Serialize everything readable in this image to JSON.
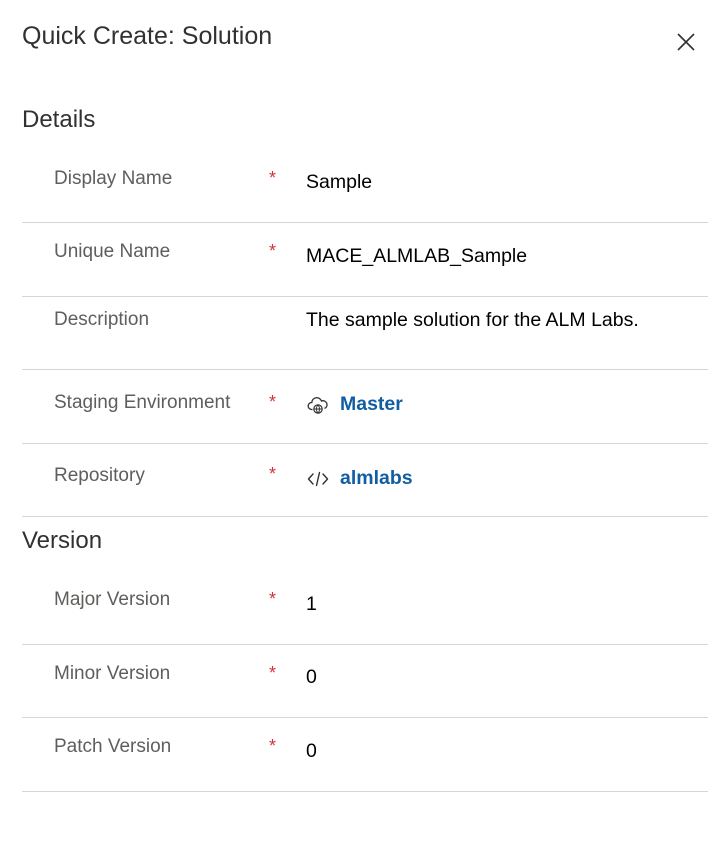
{
  "panel": {
    "title": "Quick Create: Solution",
    "close_label": "Close"
  },
  "sections": {
    "details": {
      "heading": "Details",
      "fields": {
        "display_name": {
          "label": "Display Name",
          "required": "*",
          "value": "Sample"
        },
        "unique_name": {
          "label": "Unique Name",
          "required": "*",
          "value": "MACE_ALMLAB_Sample"
        },
        "description": {
          "label": "Description",
          "value": "The sample solution for the ALM Labs."
        },
        "staging_environment": {
          "label": "Staging Environment",
          "required": "*",
          "value": "Master",
          "icon": "cloud-globe-icon"
        },
        "repository": {
          "label": "Repository",
          "required": "*",
          "value": "almlabs",
          "icon": "code-icon"
        }
      }
    },
    "version": {
      "heading": "Version",
      "fields": {
        "major_version": {
          "label": "Major Version",
          "required": "*",
          "value": "1"
        },
        "minor_version": {
          "label": "Minor Version",
          "required": "*",
          "value": "0"
        },
        "patch_version": {
          "label": "Patch Version",
          "required": "*",
          "value": "0"
        }
      }
    }
  },
  "colors": {
    "required": "#d13438",
    "link": "#115ea3",
    "divider": "#d6d6d6"
  }
}
